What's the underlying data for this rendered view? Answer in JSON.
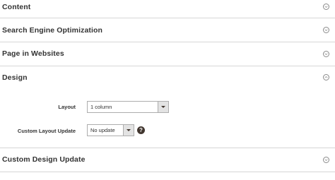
{
  "sections": [
    {
      "title": "Content",
      "expanded": false,
      "toggle_icon": "chevron-down-icon"
    },
    {
      "title": "Search Engine Optimization",
      "expanded": false,
      "toggle_icon": "chevron-down-icon"
    },
    {
      "title": "Page in Websites",
      "expanded": false,
      "toggle_icon": "chevron-down-icon"
    },
    {
      "title": "Design",
      "expanded": true,
      "toggle_icon": "chevron-up-icon"
    },
    {
      "title": "Custom Design Update",
      "expanded": false,
      "toggle_icon": "chevron-down-icon"
    }
  ],
  "design": {
    "layout": {
      "label": "Layout",
      "value": "1 column",
      "icon": "dropdown-arrow-icon"
    },
    "custom_layout_update": {
      "label": "Custom Layout Update",
      "value": "No update",
      "icon": "dropdown-arrow-icon",
      "help_icon": "?"
    }
  }
}
